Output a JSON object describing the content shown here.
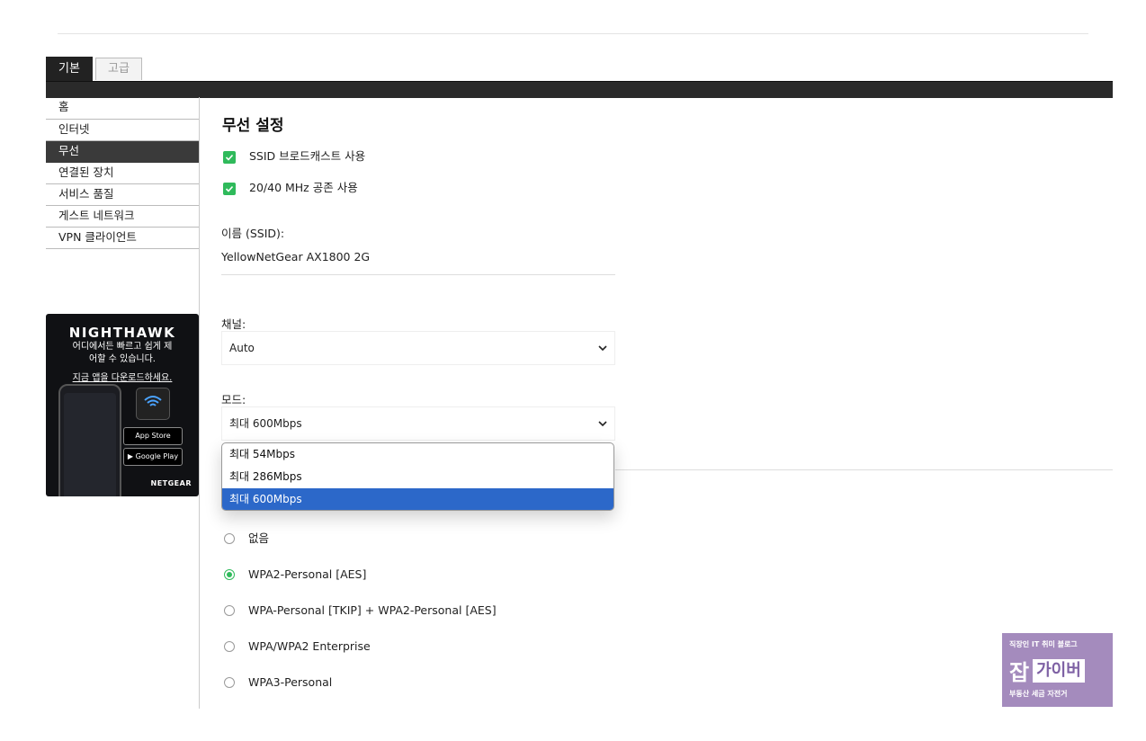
{
  "tabs": {
    "basic": "기본",
    "advanced": "고급"
  },
  "sidebar": {
    "items": [
      {
        "label": "홈"
      },
      {
        "label": "인터넷"
      },
      {
        "label": "무선"
      },
      {
        "label": "연결된 장치"
      },
      {
        "label": "서비스 품질"
      },
      {
        "label": "게스트 네트워크"
      },
      {
        "label": "VPN 클라이언트"
      }
    ],
    "active_index": 2
  },
  "ad": {
    "brand": "NIGHTHAWK",
    "line1": "어디에서든 빠르고 쉽게 제",
    "line2": "어할 수 있습니다.",
    "link": "지금 앱을 다운로드하세요.",
    "app_store": "App Store",
    "google_play": "Google Play",
    "footer": "NETGEAR"
  },
  "main": {
    "title": "무선 설정",
    "checkboxes": [
      {
        "label": "SSID 브로드캐스트 사용",
        "checked": true
      },
      {
        "label": "20/40 MHz 공존 사용",
        "checked": true
      }
    ],
    "ssid_label": "이름 (SSID):",
    "ssid_value": "YellowNetGear AX1800 2G",
    "channel_label": "채널:",
    "channel_value": "Auto",
    "mode_label": "모드:",
    "mode_value": "최대 600Mbps",
    "mode_options": [
      "최대 54Mbps",
      "최대 286Mbps",
      "최대 600Mbps"
    ],
    "mode_selected_index": 2,
    "security_options": [
      {
        "label": "없음",
        "selected": false
      },
      {
        "label": "WPA2-Personal [AES]",
        "selected": true
      },
      {
        "label": "WPA-Personal [TKIP] + WPA2-Personal [AES]",
        "selected": false
      },
      {
        "label": "WPA/WPA2 Enterprise",
        "selected": false
      },
      {
        "label": "WPA3-Personal",
        "selected": false
      }
    ]
  },
  "watermark": {
    "top": "직장인 IT 취미 블로그",
    "big": "잡",
    "box": "가이버",
    "bottom": "부동산 세금 자전거"
  },
  "colors": {
    "accent_green": "#2fba5b",
    "select_blue": "#2c68c9",
    "watermark_purple": "#a48bbd"
  }
}
